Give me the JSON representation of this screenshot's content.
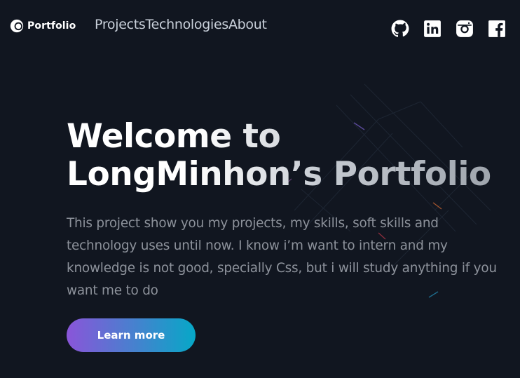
{
  "header": {
    "logo_text": "Portfolio",
    "nav": [
      {
        "label": "Projects"
      },
      {
        "label": "Technologies"
      },
      {
        "label": "About"
      }
    ],
    "socials": [
      {
        "icon": "github-icon"
      },
      {
        "icon": "linkedin-icon"
      },
      {
        "icon": "instagram-icon"
      },
      {
        "icon": "facebook-icon"
      }
    ]
  },
  "hero": {
    "title_line1": "Welcome to",
    "title_line2": "LongMinhon’s Portfolio",
    "description": "This project show you my projects, my skills, soft skills and technology uses until now. I know i’m want to intern and my knowledge is not good, specially Css, but i will study anything if you want me to do",
    "cta_label": "Learn more"
  },
  "colors": {
    "background": "#111620",
    "text_primary": "#ffffff",
    "nav_text": "#c9d0da",
    "description_text": "#8d929b",
    "cta_gradient_start": "#8a55d9",
    "cta_gradient_end": "#06a8c7"
  }
}
